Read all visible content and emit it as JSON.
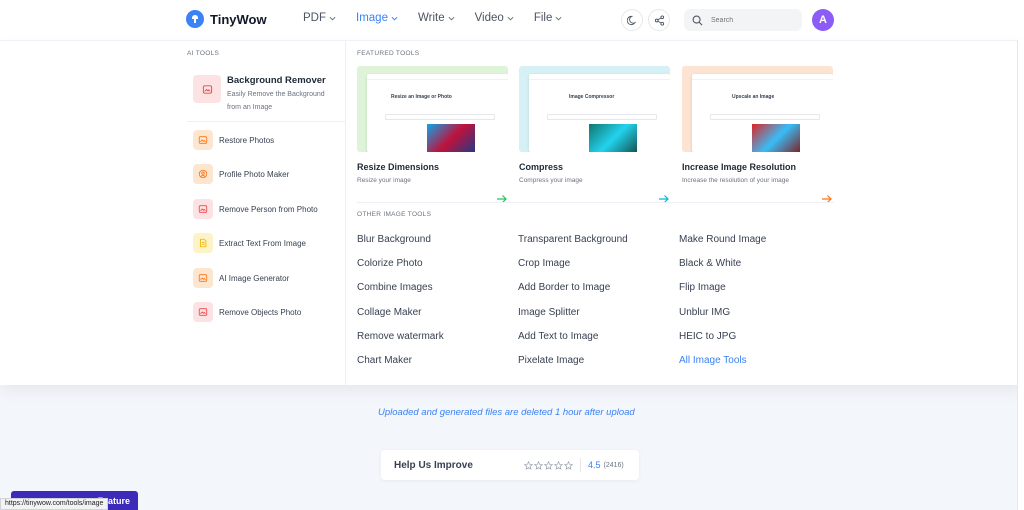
{
  "header": {
    "brand": "TinyWow",
    "nav": [
      {
        "label": "PDF",
        "active": false
      },
      {
        "label": "Image",
        "active": true
      },
      {
        "label": "Write",
        "active": false
      },
      {
        "label": "Video",
        "active": false
      },
      {
        "label": "File",
        "active": false
      }
    ],
    "search_placeholder": "Search",
    "avatar_initial": "A"
  },
  "ai_tools": {
    "title": "AI TOOLS",
    "featured": {
      "name": "Background Remover",
      "desc": "Easily Remove the Background from an Image",
      "icon": "image-icon"
    },
    "items": [
      {
        "label": "Restore Photos",
        "icon": "image-icon",
        "color": "orange"
      },
      {
        "label": "Profile Photo Maker",
        "icon": "user-circle-icon",
        "color": "orange"
      },
      {
        "label": "Remove Person from Photo",
        "icon": "image-icon",
        "color": "pink"
      },
      {
        "label": "Extract Text From Image",
        "icon": "document-icon",
        "color": "yellow"
      },
      {
        "label": "AI Image Generator",
        "icon": "image-icon",
        "color": "orange"
      },
      {
        "label": "Remove Objects Photo",
        "icon": "image-icon",
        "color": "pink"
      }
    ]
  },
  "featured_tools": {
    "title": "FEATURED TOOLS",
    "cards": [
      {
        "name": "Resize Dimensions",
        "desc": "Resize your image",
        "preview_heading": "Resize an Image or Photo",
        "bg": "#dff3d9",
        "arrow_color": "#22c55e"
      },
      {
        "name": "Compress",
        "desc": "Compress your image",
        "preview_heading": "Image Compressor",
        "bg": "#d6f1f5",
        "arrow_color": "#06b6d4"
      },
      {
        "name": "Increase Image Resolution",
        "desc": "Increase the resolution of your image",
        "preview_heading": "Upscale an Image",
        "bg": "#fde4d2",
        "arrow_color": "#f97316"
      }
    ]
  },
  "other_tools": {
    "title": "OTHER IMAGE TOOLS",
    "columns": [
      [
        "Blur Background",
        "Colorize Photo",
        "Combine Images",
        "Collage Maker",
        "Remove watermark",
        "Chart Maker"
      ],
      [
        "Transparent Background",
        "Crop Image",
        "Add Border to Image",
        "Image Splitter",
        "Add Text to Image",
        "Pixelate Image"
      ],
      [
        "Make Round Image",
        "Black & White",
        "Flip Image",
        "Unblur IMG",
        "HEIC to JPG",
        "All Image Tools"
      ]
    ]
  },
  "notice": "Uploaded and generated files are deleted 1 hour after upload",
  "feedback": {
    "label": "Help Us Improve",
    "rating": "4.5",
    "count": "(2416)",
    "stars": 5
  },
  "request_feature": "Feature",
  "status_url": "https://tinywow.com/tools/image",
  "colors": {
    "accent": "#3b82f6",
    "avatar": "#8b5cf6",
    "badge": "#3b2bb8"
  }
}
